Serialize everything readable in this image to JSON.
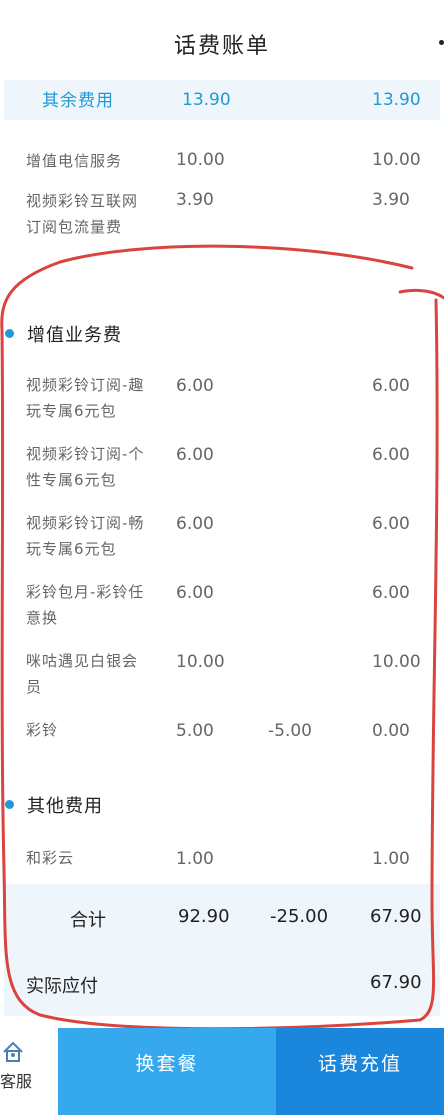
{
  "header": {
    "title": "话费账单"
  },
  "summary_row": {
    "label": "其余费用",
    "amount": "13.90",
    "total": "13.90"
  },
  "other_items": [
    {
      "name": "增值电信服务",
      "amount": "10.00",
      "total": "10.00"
    },
    {
      "name": "视频彩铃互联网订阅包流量费",
      "amount": "3.90",
      "total": "3.90"
    }
  ],
  "sections": {
    "vas": {
      "title": "增值业务费",
      "items": [
        {
          "name": "视频彩铃订阅-趣玩专属6元包",
          "amount": "6.00",
          "discount": "",
          "total": "6.00"
        },
        {
          "name": "视频彩铃订阅-个性专属6元包",
          "amount": "6.00",
          "discount": "",
          "total": "6.00"
        },
        {
          "name": "视频彩铃订阅-畅玩专属6元包",
          "amount": "6.00",
          "discount": "",
          "total": "6.00"
        },
        {
          "name": "彩铃包月-彩铃任意换",
          "amount": "6.00",
          "discount": "",
          "total": "6.00"
        },
        {
          "name": "咪咕遇见白银会员",
          "amount": "10.00",
          "discount": "",
          "total": "10.00"
        },
        {
          "name": "彩铃",
          "amount": "5.00",
          "discount": "-5.00",
          "total": "0.00"
        }
      ]
    },
    "other": {
      "title": "其他费用",
      "items": [
        {
          "name": "和彩云",
          "amount": "1.00",
          "discount": "",
          "total": "1.00"
        }
      ]
    }
  },
  "totals": {
    "label": "合计",
    "amount": "92.90",
    "discount": "-25.00",
    "total": "67.90",
    "payable_label": "实际应付",
    "payable": "67.90"
  },
  "bottom_bar": {
    "customer_service_label": "客服",
    "change_plan_label": "换套餐",
    "recharge_label": "话费充值"
  },
  "colors": {
    "accent": "#1f9ad6",
    "button_light": "#36a9ee",
    "button_dark": "#1a87dc",
    "annotation": "#d9443f"
  }
}
